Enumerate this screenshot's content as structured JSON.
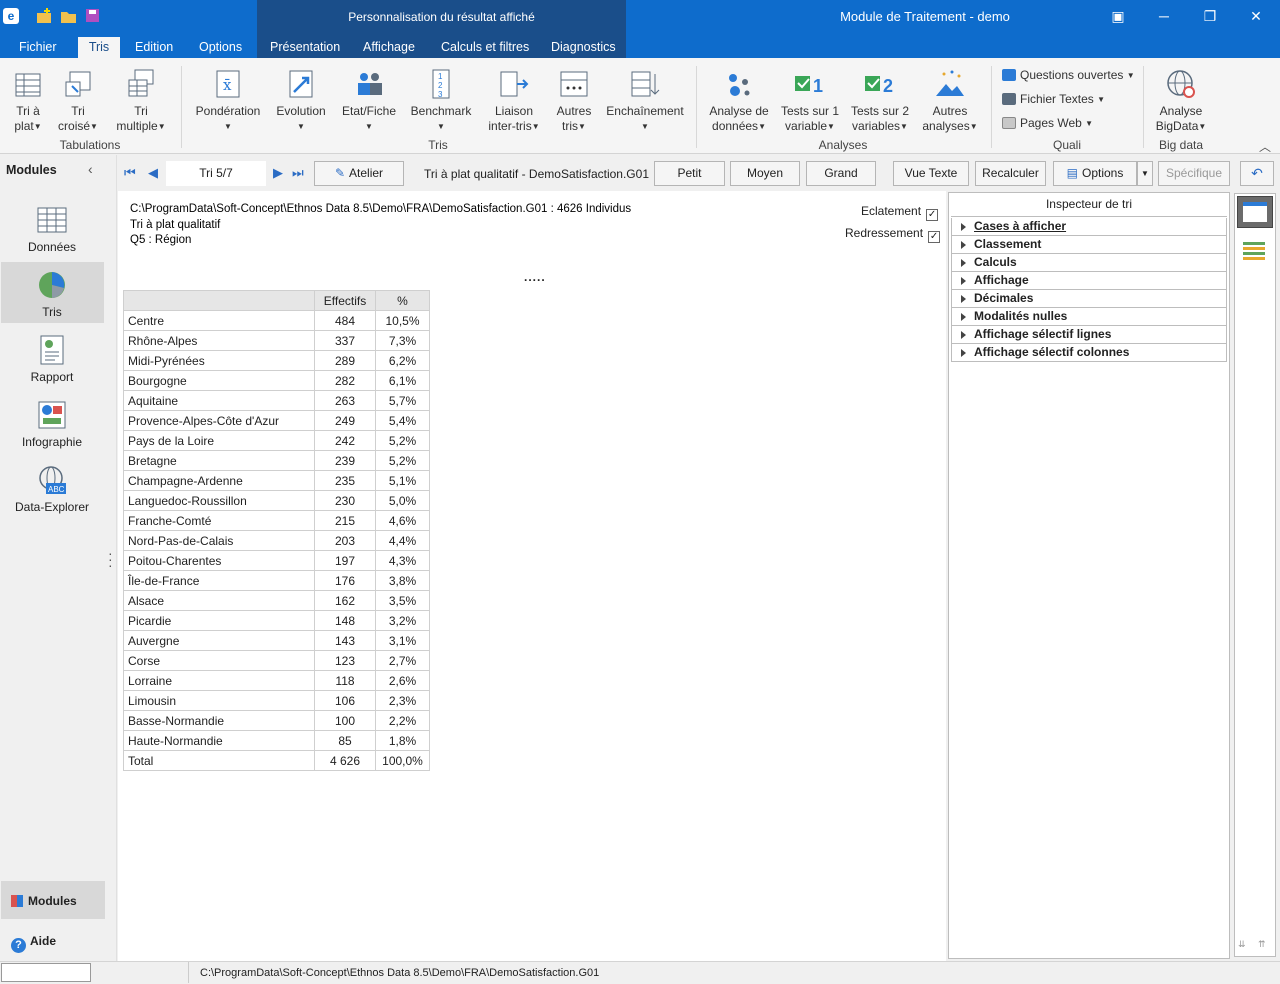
{
  "window": {
    "context_title": "Personnalisation du résultat affiché",
    "app_title": "Module de Traitement - demo"
  },
  "tabs": [
    "Fichier",
    "Tris",
    "Edition",
    "Options",
    "Présentation",
    "Affichage",
    "Calculs et filtres",
    "Diagnostics"
  ],
  "ribbon": {
    "tri_a_plat": "Tri à\nplat",
    "tri_croise": "Tri\ncroisé",
    "tri_multiple": "Tri\nmultiple",
    "group_tabulations": "Tabulations",
    "ponderation": "Pondération",
    "evolution": "Evolution",
    "etat_fiche": "Etat/Fiche",
    "benchmark": "Benchmark",
    "liaison": "Liaison\ninter-tris",
    "autres_tris": "Autres\ntris",
    "enchainement": "Enchaînement",
    "group_tris": "Tris",
    "analyse_donnees": "Analyse de\ndonnées",
    "tests1": "Tests sur 1\nvariable",
    "tests2": "Tests sur 2\nvariables",
    "autres_analyses": "Autres\nanalyses",
    "group_analyses": "Analyses",
    "questions_ouvertes": "Questions ouvertes",
    "fichier_textes": "Fichier Textes",
    "pages_web": "Pages Web",
    "group_quali": "Quali",
    "analyse_bigdata": "Analyse\nBigData",
    "group_bigdata": "Big data"
  },
  "sidebar": {
    "header": "Modules",
    "items": [
      "Données",
      "Tris",
      "Rapport",
      "Infographie",
      "Data-Explorer"
    ],
    "bottom_modules": "Modules",
    "bottom_aide": "Aide"
  },
  "toolbar": {
    "tri_counter": "Tri 5/7",
    "atelier": "Atelier",
    "current_tri": "Tri à plat qualitatif - DemoSatisfaction.G01",
    "petit": "Petit",
    "moyen": "Moyen",
    "grand": "Grand",
    "vue_texte": "Vue Texte",
    "recalculer": "Recalculer",
    "options": "Options",
    "specifique": "Spécifique"
  },
  "report": {
    "path_line": "C:\\ProgramData\\Soft-Concept\\Ethnos Data 8.5\\Demo\\FRA\\DemoSatisfaction.G01 : 4626 Individus",
    "type_line": "Tri à plat qualitatif",
    "question_line": "Q5  : Région",
    "dots": ".....",
    "eclatement": "Eclatement",
    "redressement": "Redressement"
  },
  "table": {
    "headers": [
      "",
      "Effectifs",
      "%"
    ],
    "rows": [
      [
        "Centre",
        "484",
        "10,5%"
      ],
      [
        "Rhône-Alpes",
        "337",
        "7,3%"
      ],
      [
        "Midi-Pyrénées",
        "289",
        "6,2%"
      ],
      [
        "Bourgogne",
        "282",
        "6,1%"
      ],
      [
        "Aquitaine",
        "263",
        "5,7%"
      ],
      [
        "Provence-Alpes-Côte d'Azur",
        "249",
        "5,4%"
      ],
      [
        "Pays de la Loire",
        "242",
        "5,2%"
      ],
      [
        "Bretagne",
        "239",
        "5,2%"
      ],
      [
        "Champagne-Ardenne",
        "235",
        "5,1%"
      ],
      [
        "Languedoc-Roussillon",
        "230",
        "5,0%"
      ],
      [
        "Franche-Comté",
        "215",
        "4,6%"
      ],
      [
        "Nord-Pas-de-Calais",
        "203",
        "4,4%"
      ],
      [
        "Poitou-Charentes",
        "197",
        "4,3%"
      ],
      [
        "Île-de-France",
        "176",
        "3,8%"
      ],
      [
        "Alsace",
        "162",
        "3,5%"
      ],
      [
        "Picardie",
        "148",
        "3,2%"
      ],
      [
        "Auvergne",
        "143",
        "3,1%"
      ],
      [
        "Corse",
        "123",
        "2,7%"
      ],
      [
        "Lorraine",
        "118",
        "2,6%"
      ],
      [
        "Limousin",
        "106",
        "2,3%"
      ],
      [
        "Basse-Normandie",
        "100",
        "2,2%"
      ],
      [
        "Haute-Normandie",
        "85",
        "1,8%"
      ],
      [
        "Total",
        "4 626",
        "100,0%"
      ]
    ]
  },
  "inspector": {
    "title": "Inspecteur de tri",
    "sections": [
      "Cases à afficher",
      "Classement",
      "Calculs",
      "Affichage",
      "Décimales",
      "Modalités nulles",
      "Affichage sélectif lignes",
      "Affichage sélectif colonnes"
    ]
  },
  "status": {
    "path": "C:\\ProgramData\\Soft-Concept\\Ethnos Data 8.5\\Demo\\FRA\\DemoSatisfaction.G01"
  },
  "colors": {
    "title_blue": "#0e6ccc",
    "context_blue": "#1a4e8a"
  }
}
